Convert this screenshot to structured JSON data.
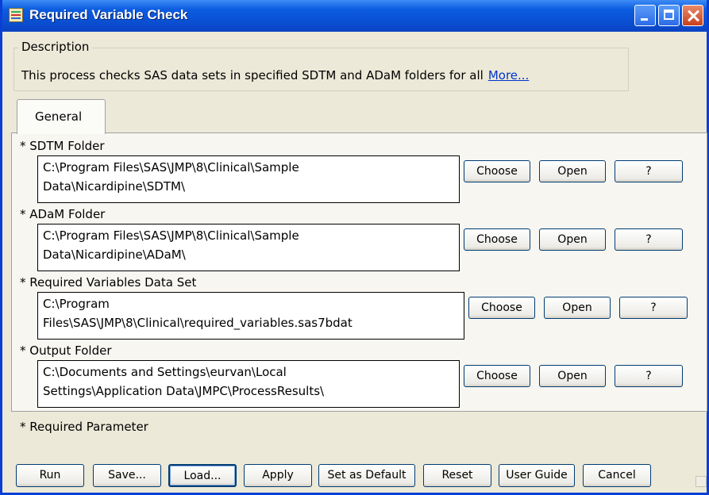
{
  "window": {
    "title": "Required Variable Check"
  },
  "description": {
    "legend": "Description",
    "text": "This process checks SAS data sets in specified SDTM and ADaM folders for all",
    "more_link": "More..."
  },
  "tabs": [
    {
      "label": "General"
    }
  ],
  "fields": [
    {
      "label": "* SDTM Folder",
      "line1": "C:\\Program Files\\SAS\\JMP\\8\\Clinical\\Sample",
      "line2": "Data\\Nicardipine\\SDTM\\"
    },
    {
      "label": "* ADaM Folder",
      "line1": "C:\\Program Files\\SAS\\JMP\\8\\Clinical\\Sample",
      "line2": "Data\\Nicardipine\\ADaM\\"
    },
    {
      "label": "* Required Variables Data Set",
      "line1": "C:\\Program",
      "line2": "Files\\SAS\\JMP\\8\\Clinical\\required_variables.sas7bdat"
    },
    {
      "label": "* Output Folder",
      "line1": "C:\\Documents and Settings\\eurvan\\Local",
      "line2": "Settings\\Application Data\\JMPC\\ProcessResults\\"
    }
  ],
  "field_buttons": {
    "choose": "Choose",
    "open": "Open",
    "help": "?"
  },
  "required_note": "* Required Parameter",
  "bottom_buttons": {
    "run": "Run",
    "save": "Save...",
    "load": "Load...",
    "apply": "Apply",
    "set_default": "Set as Default",
    "reset": "Reset",
    "user_guide": "User Guide",
    "cancel": "Cancel"
  }
}
